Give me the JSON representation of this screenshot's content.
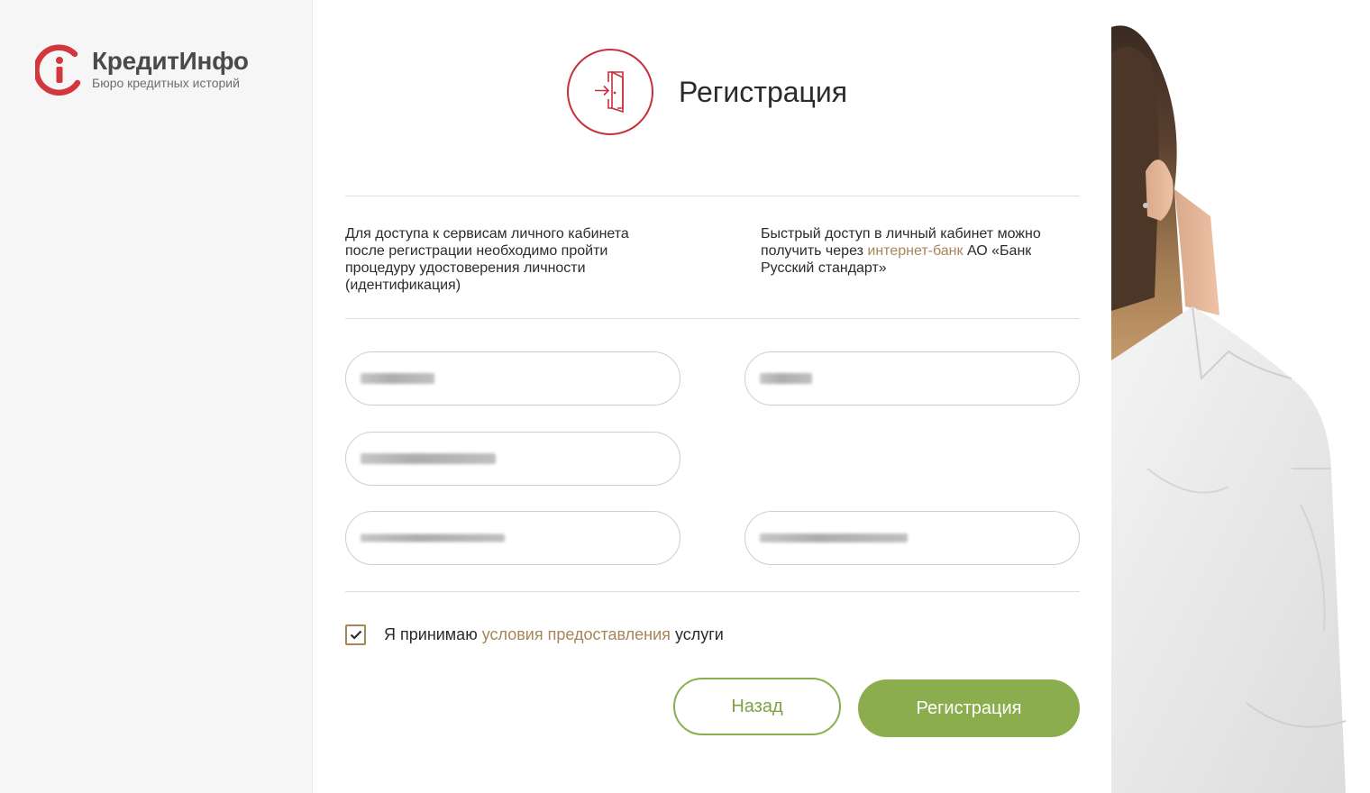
{
  "brand": {
    "name": "КредитИнфо",
    "tagline": "Бюро кредитных историй",
    "accent_color": "#c7303a"
  },
  "header": {
    "icon": "door-enter-icon",
    "title": "Регистрация"
  },
  "info": {
    "left_text": "Для доступа к сервисам личного кабинета после регистрации необходимо пройти процедуру удостоверения личности (идентификация)",
    "right_prefix": "Быстрый доступ в личный кабинет можно получить через ",
    "right_link": "интернет-банк",
    "right_suffix": " АО «Банк Русский стандарт»"
  },
  "form": {
    "fields": [
      {
        "value": ""
      },
      {
        "value": ""
      },
      {
        "value": ""
      },
      {
        "value": ""
      },
      {
        "value": ""
      }
    ]
  },
  "consent": {
    "checked": true,
    "prefix": "Я принимаю ",
    "link": "условия предоставления",
    "suffix": " услуги"
  },
  "actions": {
    "back_label": "Назад",
    "submit_label": "Регистрация"
  },
  "colors": {
    "primary_green": "#8bad4e",
    "link_gold": "#a6865a",
    "accent_red": "#c7303a"
  }
}
